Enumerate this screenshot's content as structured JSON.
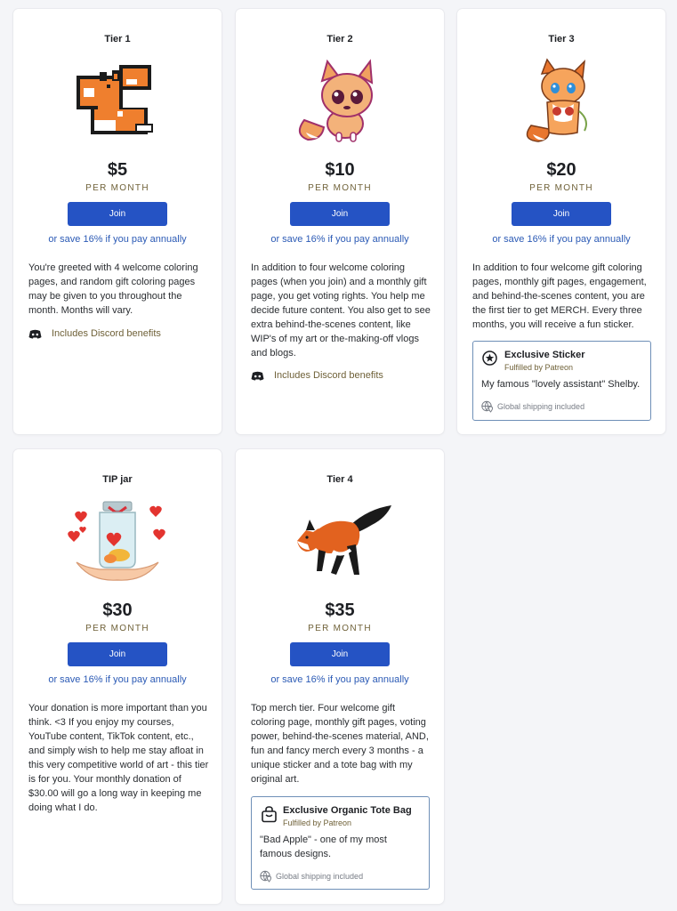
{
  "common": {
    "per_month": "PER MONTH",
    "join_label": "Join",
    "annual_text": "or save 16% if you pay annually",
    "discord_text": "Includes Discord benefits",
    "fulfilled_by": "Fulfilled by Patreon",
    "shipping_text": "Global shipping included",
    "accent_color": "#2553c4"
  },
  "tiers": [
    {
      "name": "Tier 1",
      "price": "$5",
      "image": "pixel-fox-icon",
      "description": "You're greeted with 4 welcome coloring pages, and random gift coloring pages may be given to you throughout the month. Months will vary."
    },
    {
      "name": "Tier 2",
      "price": "$10",
      "image": "chibi-fox-icon",
      "description": "In addition to four welcome coloring pages (when you join) and a monthly gift page, you get voting rights. You help me decide future content. You also get to see extra behind-the-scenes content, like WIP's of my art or the-making-off vlogs and blogs."
    },
    {
      "name": "Tier 3",
      "price": "$20",
      "image": "fox-girl-icon",
      "description": "In addition to four welcome gift coloring pages, monthly gift pages, engagement, and behind-the-scenes content, you are the first tier to get MERCH. Every three months, you will receive a fun sticker.",
      "benefit": {
        "title": "Exclusive Sticker",
        "description": "My famous \"lovely assistant\" Shelby."
      }
    },
    {
      "name": "TIP jar",
      "price": "$30",
      "image": "tip-jar-hearts-icon",
      "description": "Your donation is more important than you think. <3 If you enjoy my courses, YouTube content, TikTok content, etc., and simply wish to help me stay afloat in this very competitive world of art - this tier is for you.  Your monthly donation of $30.00 will go a long way in keeping me doing what I do."
    },
    {
      "name": "Tier 4",
      "price": "$35",
      "image": "running-fox-icon",
      "description": "Top merch tier. Four welcome gift coloring page, monthly gift pages, voting power, behind-the-scenes material, AND, fun and fancy merch every 3 months - a unique sticker and a tote bag with my original art.",
      "benefit": {
        "title": "Exclusive Organic Tote Bag",
        "description": "\"Bad Apple\" - one of my most famous designs."
      }
    }
  ]
}
